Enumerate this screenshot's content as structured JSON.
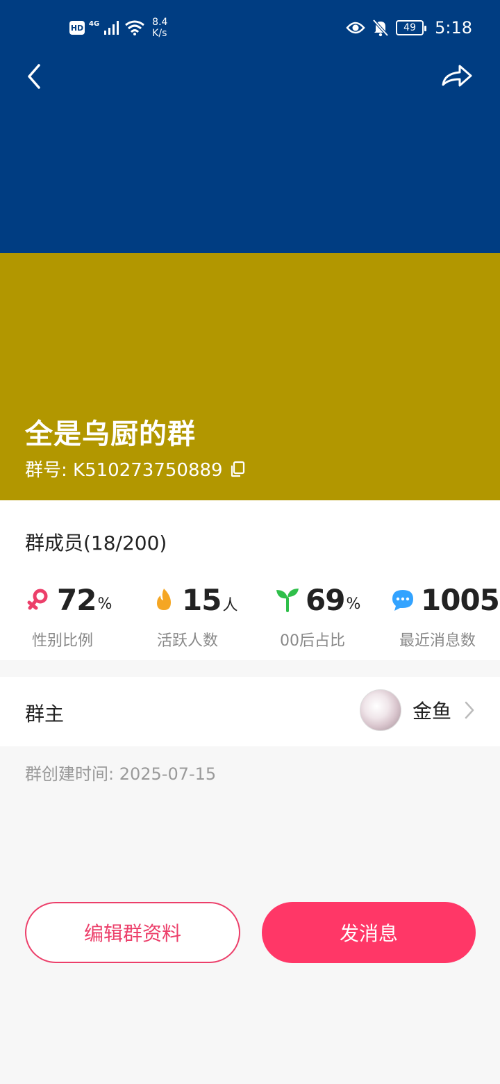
{
  "status_bar": {
    "hd": "HD",
    "network": "4G",
    "speed_line1": "8.4",
    "speed_line2": "K/s",
    "battery": "49",
    "time": "5:18"
  },
  "header": {
    "back_icon": "chevron-left-icon",
    "share_icon": "share-arrow-icon",
    "colors": {
      "top": "#003d82",
      "bottom": "#b29700"
    }
  },
  "group": {
    "name": "全是乌厨的群",
    "id_label": "群号: K510273750889",
    "copy_icon": "copy-icon"
  },
  "members": {
    "title": "群成员(18/200)",
    "stats": [
      {
        "icon": "female-symbol-icon",
        "value": "72",
        "unit": "%",
        "label": "性别比例",
        "color": "#ec3f6a"
      },
      {
        "icon": "flame-icon",
        "value": "15",
        "unit": "人",
        "label": "活跃人数",
        "color": "#f5a623"
      },
      {
        "icon": "sprout-icon",
        "value": "69",
        "unit": "%",
        "label": "00后占比",
        "color": "#2fbf4a"
      },
      {
        "icon": "chat-bubble-icon",
        "value": "1005",
        "unit": "+",
        "label": "最近消息数",
        "color": "#33a3ff"
      }
    ]
  },
  "owner": {
    "label": "群主",
    "name": "金鱼"
  },
  "created": "群创建时间: 2025-07-15",
  "actions": {
    "edit": "编辑群资料",
    "send": "发消息",
    "accent": "#ff3767"
  }
}
